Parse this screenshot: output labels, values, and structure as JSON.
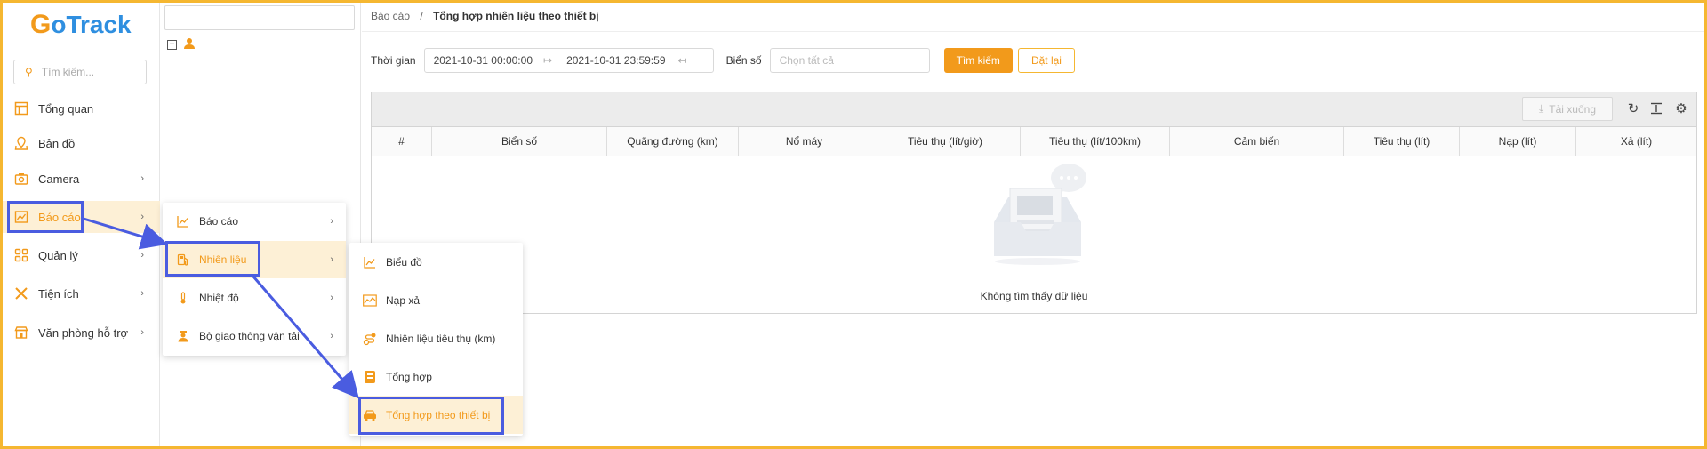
{
  "logo": {
    "letter": "G",
    "text": "oTrack"
  },
  "sidebar": {
    "search_placeholder": "Tìm kiếm...",
    "items": [
      {
        "label": "Tổng quan",
        "icon": "dashboard-icon"
      },
      {
        "label": "Bản đồ",
        "icon": "map-icon"
      },
      {
        "label": "Camera",
        "icon": "camera-icon"
      },
      {
        "label": "Báo cáo",
        "icon": "report-icon"
      },
      {
        "label": "Quản lý",
        "icon": "grid-icon"
      },
      {
        "label": "Tiện ích",
        "icon": "tools-icon"
      },
      {
        "label": "Văn phòng hỗ trợ",
        "icon": "store-icon"
      }
    ]
  },
  "breadcrumb": {
    "parent": "Báo cáo",
    "separator": "/",
    "current": "Tổng hợp nhiên liệu theo thiết bị"
  },
  "filter": {
    "time_label": "Thời gian",
    "start": "2021-10-31 00:00:00",
    "end": "2021-10-31 23:59:59",
    "plate_label": "Biển số",
    "plate_placeholder": "Chọn tất cả",
    "search_btn": "Tìm kiếm",
    "reset_btn": "Đặt lại"
  },
  "table": {
    "download_label": "Tải xuống",
    "columns": [
      "#",
      "Biển số",
      "Quãng đường (km)",
      "Nổ máy",
      "Tiêu thụ (lít/giờ)",
      "Tiêu thụ (lít/100km)",
      "Cảm biến",
      "Tiêu thụ (lít)",
      "Nạp (lít)",
      "Xả (lít)"
    ],
    "empty_text": "Không tìm thấy dữ liệu"
  },
  "menu_report": [
    {
      "label": "Báo cáo",
      "icon": "line-chart-icon"
    },
    {
      "label": "Nhiên liệu",
      "icon": "fuel-pump-icon"
    },
    {
      "label": "Nhiệt độ",
      "icon": "thermometer-icon"
    },
    {
      "label": "Bộ giao thông vận tải",
      "icon": "officer-icon"
    }
  ],
  "menu_fuel": [
    {
      "label": "Biểu đồ",
      "icon": "line-chart-icon"
    },
    {
      "label": "Nạp xả",
      "icon": "area-chart-icon"
    },
    {
      "label": "Nhiên liệu tiêu thụ (km)",
      "icon": "route-icon"
    },
    {
      "label": "Tổng hợp",
      "icon": "fuel-summary-icon"
    },
    {
      "label": "Tổng hợp theo thiết bị",
      "icon": "car-icon"
    }
  ],
  "colors": {
    "accent": "#f29a1b",
    "brand_blue": "#2f8fe0",
    "annotation": "#4a5ce0",
    "frame": "#f5b731"
  }
}
